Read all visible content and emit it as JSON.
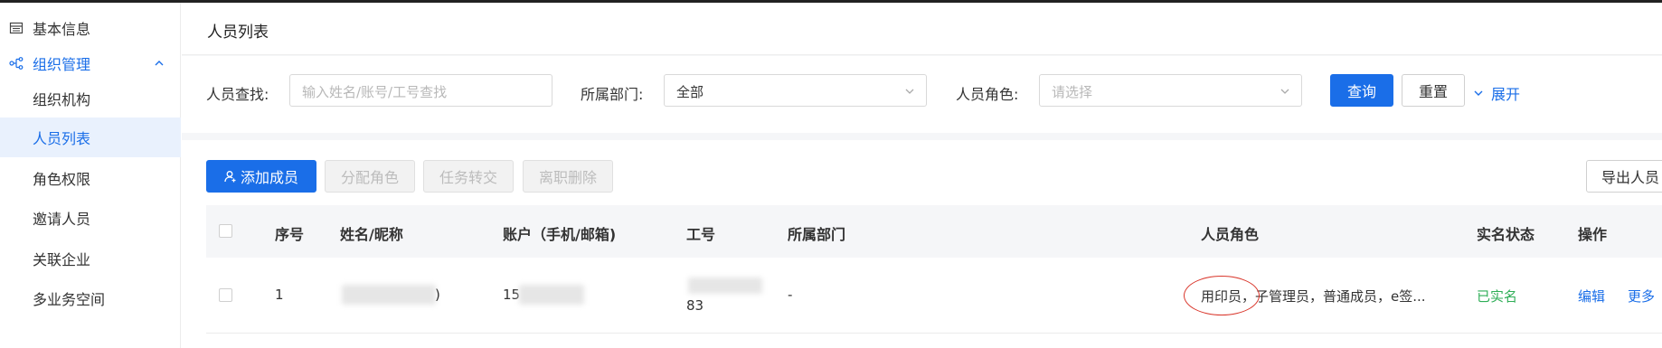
{
  "sidebar": {
    "items": [
      {
        "label": "基本信息",
        "icon": "table-icon"
      },
      {
        "label": "组织管理",
        "icon": "org-tree-icon",
        "expanded": true
      },
      {
        "label": "组织机构"
      },
      {
        "label": "人员列表",
        "active": true
      },
      {
        "label": "角色权限"
      },
      {
        "label": "邀请人员"
      },
      {
        "label": "关联企业"
      },
      {
        "label": "多业务空间"
      }
    ]
  },
  "header": {
    "title": "人员列表"
  },
  "filters": {
    "search_label": "人员查找:",
    "search_placeholder": "输入姓名/账号/工号查找",
    "dept_label": "所属部门:",
    "dept_value": "全部",
    "role_label": "人员角色:",
    "role_placeholder": "请选择",
    "query_button": "查询",
    "reset_button": "重置",
    "expand_link": "展开"
  },
  "toolbar": {
    "add_member": "添加成员",
    "assign_role": "分配角色",
    "transfer_task": "任务转交",
    "resign_delete": "离职删除",
    "export": "导出人员"
  },
  "table": {
    "columns": [
      "序号",
      "姓名/昵称",
      "账户（手机/邮箱)",
      "工号",
      "所属部门",
      "人员角色",
      "实名状态",
      "操作"
    ],
    "rows": [
      {
        "index": "1",
        "name_suffix": ")",
        "account_prefix": "15",
        "job_no_suffix": "83",
        "department": "-",
        "roles": "用印员，子管理员，普通成员，e签...",
        "status": "已实名",
        "edit": "编辑",
        "more": "更多"
      }
    ]
  },
  "colors": {
    "accent": "#1a6ee8",
    "success": "#2fae57",
    "annotation": "#d9352a"
  }
}
